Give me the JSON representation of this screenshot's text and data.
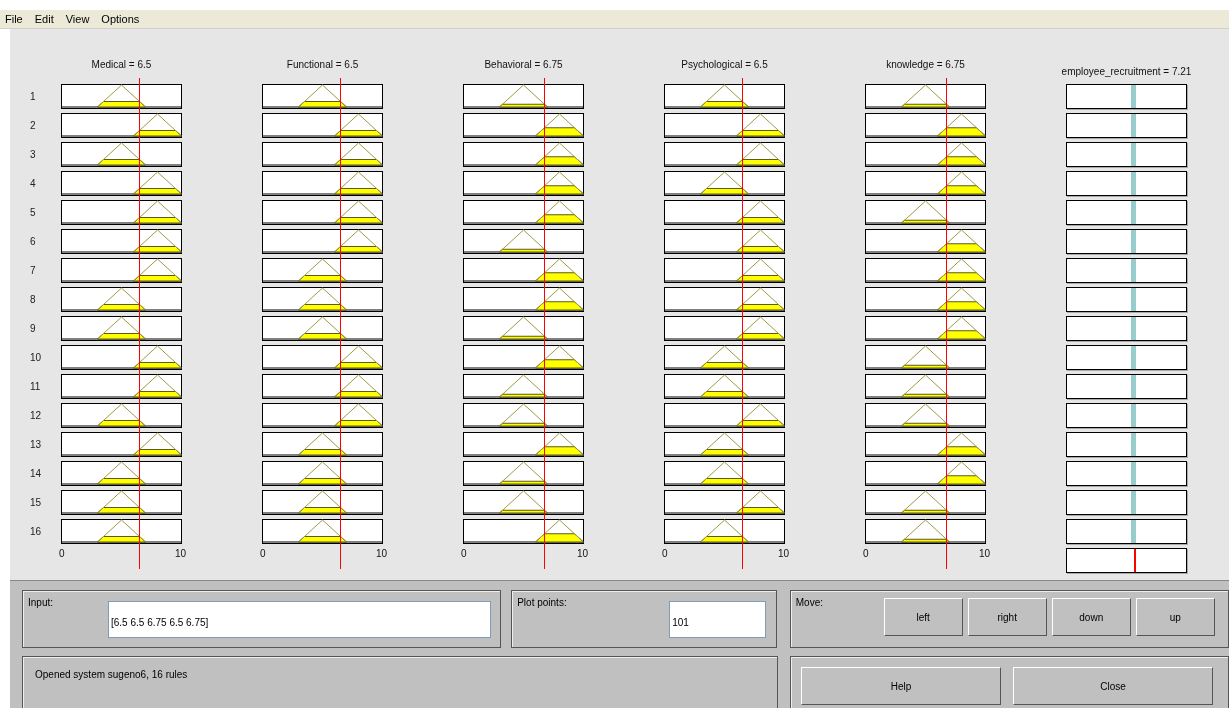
{
  "menu": [
    "File",
    "Edit",
    "View",
    "Options"
  ],
  "rule_numbers": [
    "1",
    "2",
    "3",
    "4",
    "5",
    "6",
    "7",
    "8",
    "9",
    "10",
    "11",
    "12",
    "13",
    "14",
    "15",
    "16"
  ],
  "inputs": [
    {
      "title": "Medical = 6.5",
      "axis": [
        "0",
        "10"
      ],
      "rules": [
        {
          "kind": "mid"
        },
        {
          "kind": "high"
        },
        {
          "kind": "mid"
        },
        {
          "kind": "high"
        },
        {
          "kind": "high"
        },
        {
          "kind": "high"
        },
        {
          "kind": "high"
        },
        {
          "kind": "mid"
        },
        {
          "kind": "mid"
        },
        {
          "kind": "high"
        },
        {
          "kind": "high"
        },
        {
          "kind": "mid"
        },
        {
          "kind": "high"
        },
        {
          "kind": "mid"
        },
        {
          "kind": "mid"
        },
        {
          "kind": "mid"
        }
      ]
    },
    {
      "title": "Functional = 6.5",
      "axis": [
        "0",
        "10"
      ],
      "rules": [
        {
          "kind": "mid"
        },
        {
          "kind": "high"
        },
        {
          "kind": "high"
        },
        {
          "kind": "high"
        },
        {
          "kind": "high"
        },
        {
          "kind": "high"
        },
        {
          "kind": "mid"
        },
        {
          "kind": "mid"
        },
        {
          "kind": "mid"
        },
        {
          "kind": "high"
        },
        {
          "kind": "high"
        },
        {
          "kind": "high"
        },
        {
          "kind": "mid"
        },
        {
          "kind": "mid"
        },
        {
          "kind": "mid"
        },
        {
          "kind": "mid"
        }
      ]
    },
    {
      "title": "Behavioral = 6.75",
      "axis": [
        "0",
        "10"
      ],
      "rules": [
        {
          "kind": "mid"
        },
        {
          "kind": "high"
        },
        {
          "kind": "high"
        },
        {
          "kind": "high"
        },
        {
          "kind": "high"
        },
        {
          "kind": "mid"
        },
        {
          "kind": "high"
        },
        {
          "kind": "high"
        },
        {
          "kind": "mid"
        },
        {
          "kind": "high"
        },
        {
          "kind": "mid"
        },
        {
          "kind": "mid"
        },
        {
          "kind": "high"
        },
        {
          "kind": "mid"
        },
        {
          "kind": "mid"
        },
        {
          "kind": "high"
        }
      ]
    },
    {
      "title": "Psychological = 6.5",
      "axis": [
        "0",
        "10"
      ],
      "rules": [
        {
          "kind": "mid"
        },
        {
          "kind": "high"
        },
        {
          "kind": "high"
        },
        {
          "kind": "mid"
        },
        {
          "kind": "high"
        },
        {
          "kind": "high"
        },
        {
          "kind": "high"
        },
        {
          "kind": "high"
        },
        {
          "kind": "high"
        },
        {
          "kind": "mid"
        },
        {
          "kind": "mid"
        },
        {
          "kind": "high"
        },
        {
          "kind": "mid"
        },
        {
          "kind": "mid"
        },
        {
          "kind": "high"
        },
        {
          "kind": "mid"
        }
      ]
    },
    {
      "title": "knowledge = 6.75",
      "axis": [
        "0",
        "10"
      ],
      "rules": [
        {
          "kind": "mid"
        },
        {
          "kind": "high"
        },
        {
          "kind": "high"
        },
        {
          "kind": "high"
        },
        {
          "kind": "mid"
        },
        {
          "kind": "high"
        },
        {
          "kind": "high"
        },
        {
          "kind": "high"
        },
        {
          "kind": "high"
        },
        {
          "kind": "mid"
        },
        {
          "kind": "mid"
        },
        {
          "kind": "mid"
        },
        {
          "kind": "high"
        },
        {
          "kind": "high"
        },
        {
          "kind": "mid"
        },
        {
          "kind": "mid"
        }
      ]
    }
  ],
  "output": {
    "title": "employee_recruitment = 7.21"
  },
  "input_field": {
    "label": "Input:",
    "value": "[6.5 6.5 6.75 6.5 6.75]"
  },
  "plot_points": {
    "label": "Plot points:",
    "value": "101"
  },
  "move": {
    "label": "Move:",
    "buttons": [
      "left",
      "right",
      "down",
      "up"
    ]
  },
  "status": "Opened system sugeno6, 16 rules",
  "buttons": [
    "Help",
    "Close"
  ]
}
